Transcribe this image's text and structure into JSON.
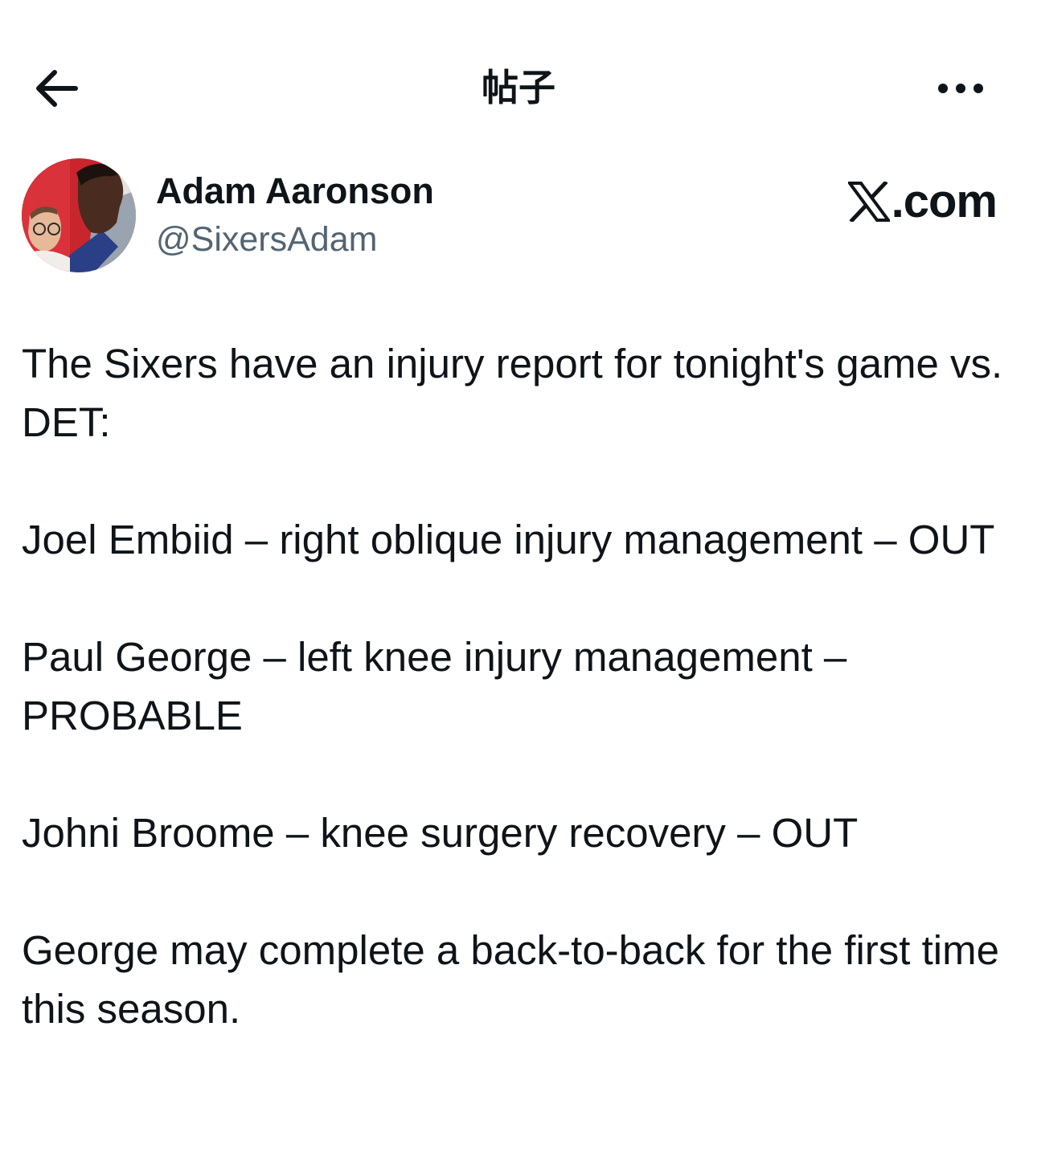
{
  "header": {
    "title": "帖子",
    "back_icon": "arrow-left-icon",
    "more_icon": "more-horizontal-icon"
  },
  "author": {
    "display_name": "Adam Aaronson",
    "handle": "@SixersAdam",
    "avatar_icon": "profile-photo"
  },
  "brand": {
    "logo_icon": "x-logo-icon",
    "text": ".com"
  },
  "post": {
    "paragraphs": [
      "The Sixers have an injury report for tonight's game vs. DET:",
      "Joel Embiid – right oblique injury management – OUT",
      "Paul George – left knee injury management – PROBABLE",
      "Johni Broome – knee surgery recovery – OUT",
      "George may complete a back-to-back for the first time this season."
    ]
  },
  "colors": {
    "text_primary": "#0f1419",
    "text_secondary": "#536471",
    "background": "#ffffff"
  }
}
